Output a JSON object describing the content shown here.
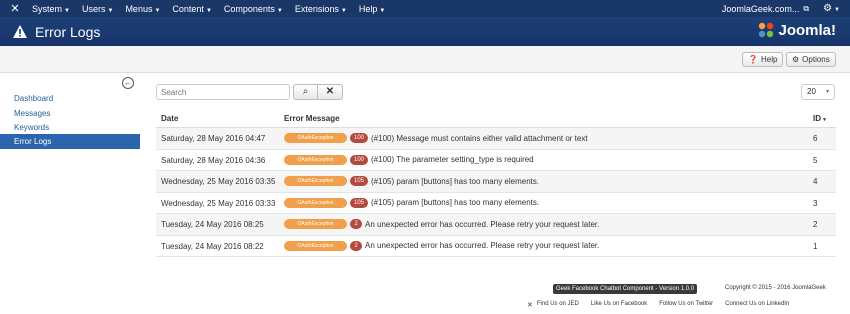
{
  "topbar": {
    "menu": [
      {
        "label": "System"
      },
      {
        "label": "Users"
      },
      {
        "label": "Menus"
      },
      {
        "label": "Content"
      },
      {
        "label": "Components"
      },
      {
        "label": "Extensions"
      },
      {
        "label": "Help"
      }
    ],
    "site_link": "JoomlaGeek.com...",
    "user_icon": "gear-icon"
  },
  "header": {
    "title": "Error Logs",
    "brand": "Joomla!"
  },
  "toolbar": {
    "help_label": "Help",
    "options_label": "Options"
  },
  "sidebar": {
    "items": [
      {
        "label": "Dashboard",
        "active": false
      },
      {
        "label": "Messages",
        "active": false
      },
      {
        "label": "Keywords",
        "active": false
      },
      {
        "label": "Error Logs",
        "active": true
      }
    ]
  },
  "filter": {
    "search_placeholder": "Search",
    "limit_value": "20"
  },
  "table": {
    "headers": {
      "date": "Date",
      "message": "Error Message",
      "id": "ID"
    },
    "rows": [
      {
        "date": "Saturday, 28 May 2016 04:47",
        "type": "OAuthException",
        "code": "100",
        "message": "(#100) Message must contains either valid attachment or text",
        "id": "6"
      },
      {
        "date": "Saturday, 28 May 2016 04:36",
        "type": "OAuthException",
        "code": "100",
        "message": "(#100) The parameter setting_type is required",
        "id": "5"
      },
      {
        "date": "Wednesday, 25 May 2016 03:35",
        "type": "OAuthException",
        "code": "105",
        "message": "(#105) param [buttons] has too many elements.",
        "id": "4"
      },
      {
        "date": "Wednesday, 25 May 2016 03:33",
        "type": "OAuthException",
        "code": "105",
        "message": "(#105) param [buttons] has too many elements.",
        "id": "3"
      },
      {
        "date": "Tuesday, 24 May 2016 08:25",
        "type": "OAuthException",
        "code": "2",
        "message": "An unexpected error has occurred. Please retry your request later.",
        "id": "2"
      },
      {
        "date": "Tuesday, 24 May 2016 08:22",
        "type": "OAuthException",
        "code": "2",
        "message": "An unexpected error has occurred. Please retry your request later.",
        "id": "1"
      }
    ]
  },
  "footer": {
    "version_badge": "Geek Facebook Chatbot Component - Version 1.0.0",
    "copyright": "Copyright © 2015 - 2016 JoomlaGeek",
    "links": [
      {
        "label": "Find Us on JED"
      },
      {
        "label": "Like Us on Facebook"
      },
      {
        "label": "Follow Us on Twitter"
      },
      {
        "label": "Connect Us on LinkedIn"
      }
    ]
  },
  "colors": {
    "nav_bg": "#1a3867",
    "active_side": "#2a65ad",
    "type_badge": "#f0a04a",
    "code_badge": "#b44a3c"
  }
}
